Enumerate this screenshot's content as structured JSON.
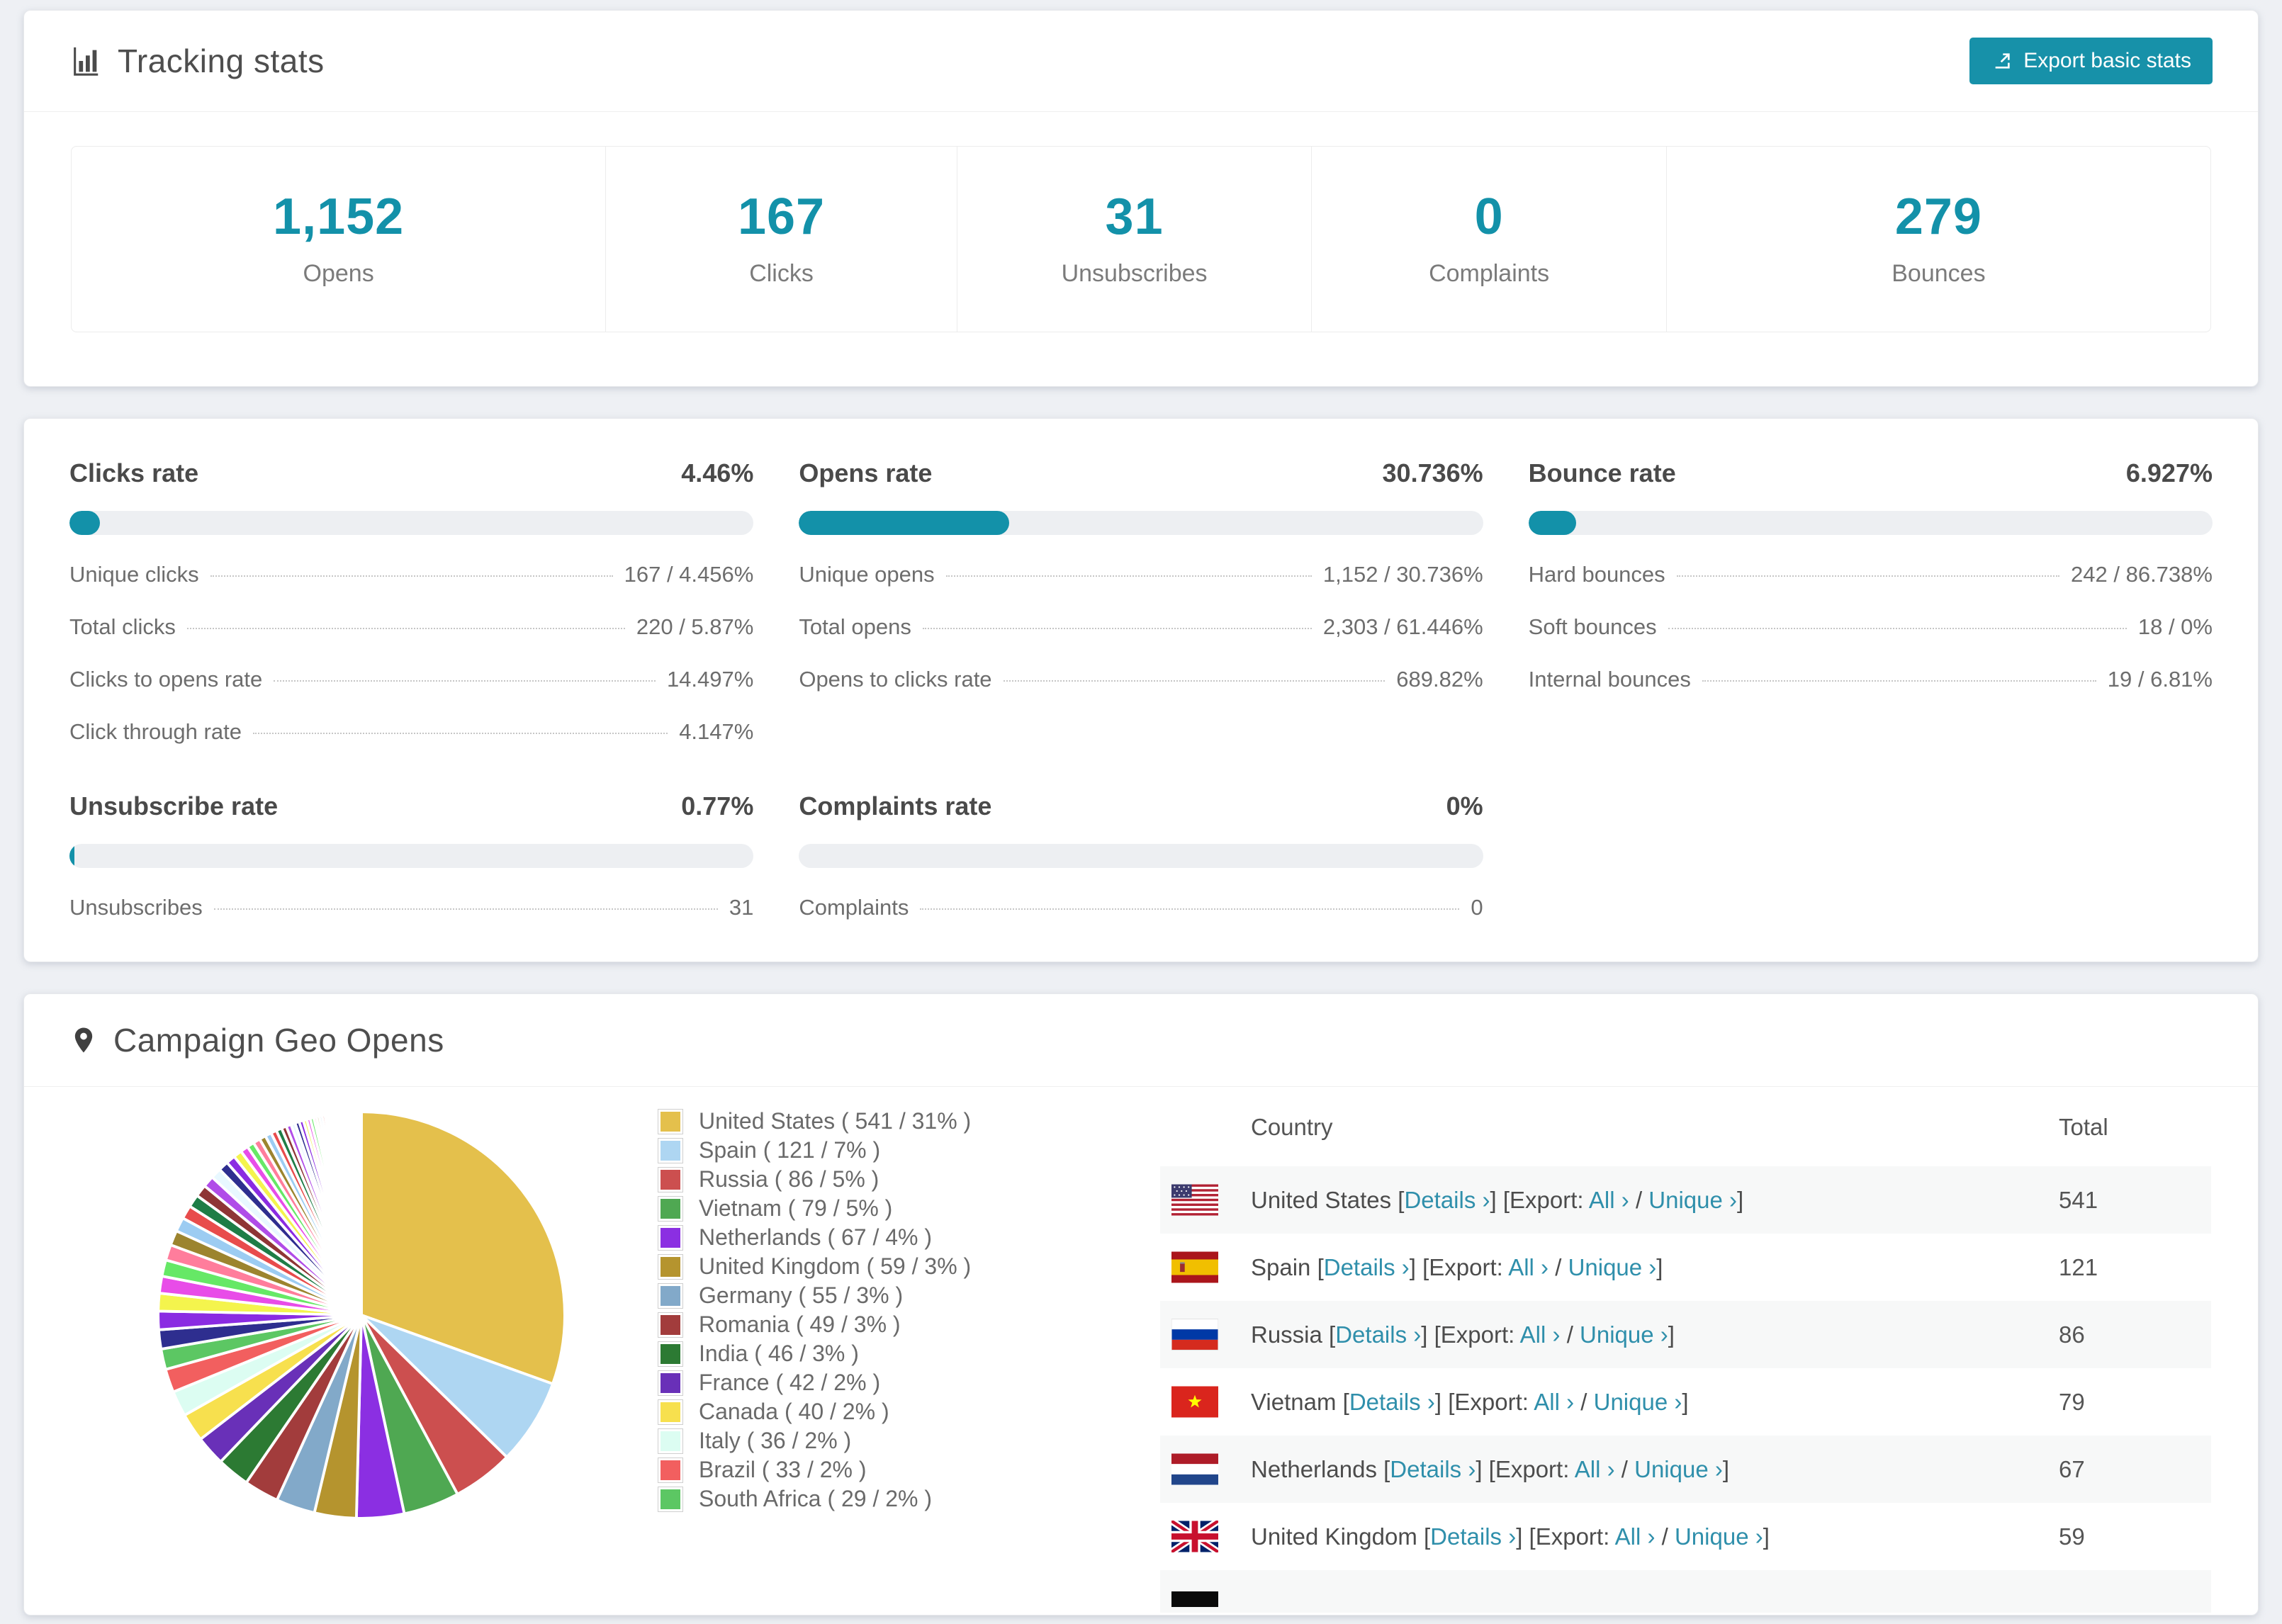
{
  "accent": "#1791a9",
  "tracking": {
    "title": "Tracking stats",
    "export_label": "Export basic stats",
    "stats": [
      {
        "value": "1,152",
        "label": "Opens"
      },
      {
        "value": "167",
        "label": "Clicks"
      },
      {
        "value": "31",
        "label": "Unsubscribes"
      },
      {
        "value": "0",
        "label": "Complaints"
      },
      {
        "value": "279",
        "label": "Bounces"
      }
    ]
  },
  "rates": [
    {
      "title": "Clicks rate",
      "value": "4.46%",
      "bar": 4.46,
      "rows": [
        {
          "label": "Unique clicks",
          "value": "167 / 4.456%"
        },
        {
          "label": "Total clicks",
          "value": "220 / 5.87%"
        },
        {
          "label": "Clicks to opens rate",
          "value": "14.497%"
        },
        {
          "label": "Click through rate",
          "value": "4.147%"
        }
      ]
    },
    {
      "title": "Opens rate",
      "value": "30.736%",
      "bar": 30.736,
      "rows": [
        {
          "label": "Unique opens",
          "value": "1,152 / 30.736%"
        },
        {
          "label": "Total opens",
          "value": "2,303 / 61.446%"
        },
        {
          "label": "Opens to clicks rate",
          "value": "689.82%"
        }
      ]
    },
    {
      "title": "Bounce rate",
      "value": "6.927%",
      "bar": 6.927,
      "rows": [
        {
          "label": "Hard bounces",
          "value": "242 / 86.738%"
        },
        {
          "label": "Soft bounces",
          "value": "18 / 0%"
        },
        {
          "label": "Internal bounces",
          "value": "19 / 6.81%"
        }
      ]
    },
    {
      "title": "Unsubscribe rate",
      "value": "0.77%",
      "bar": 0.77,
      "rows": [
        {
          "label": "Unsubscribes",
          "value": "31"
        }
      ]
    },
    {
      "title": "Complaints rate",
      "value": "0%",
      "bar": 0,
      "rows": [
        {
          "label": "Complaints",
          "value": "0"
        }
      ]
    }
  ],
  "geo": {
    "title": "Campaign Geo Opens",
    "legend": [
      {
        "label": "United States ( 541 / 31% )"
      },
      {
        "label": "Spain ( 121 / 7% )"
      },
      {
        "label": "Russia ( 86 / 5% )"
      },
      {
        "label": "Vietnam ( 79 / 5% )"
      },
      {
        "label": "Netherlands ( 67 / 4% )"
      },
      {
        "label": "United Kingdom ( 59 / 3% )"
      },
      {
        "label": "Germany ( 55 / 3% )"
      },
      {
        "label": "Romania ( 49 / 3% )"
      },
      {
        "label": "India ( 46 / 3% )"
      },
      {
        "label": "France ( 42 / 2% )"
      },
      {
        "label": "Canada ( 40 / 2% )"
      },
      {
        "label": "Italy ( 36 / 2% )"
      },
      {
        "label": "Brazil ( 33 / 2% )"
      },
      {
        "label": "South Africa ( 29 / 2% )"
      }
    ],
    "table": {
      "headers": [
        "Country",
        "Total"
      ],
      "link_labels": {
        "lb": "[",
        "rb": "]",
        "details": "Details ›",
        "export": "Export:",
        "all": "All ›",
        "slash": "/",
        "unique": "Unique ›"
      },
      "rows": [
        {
          "country": "United States",
          "total": "541"
        },
        {
          "country": "Spain",
          "total": "121"
        },
        {
          "country": "Russia",
          "total": "86"
        },
        {
          "country": "Vietnam",
          "total": "79"
        },
        {
          "country": "Netherlands",
          "total": "67"
        },
        {
          "country": "United Kingdom",
          "total": "59"
        }
      ]
    }
  },
  "chart_data": {
    "type": "pie",
    "title": "Campaign Geo Opens",
    "unit": "opens",
    "legend_position": "right",
    "series": [
      {
        "name": "United States",
        "value": 541,
        "percent": "31%",
        "color": "#e4c04c"
      },
      {
        "name": "Spain",
        "value": 121,
        "percent": "7%",
        "color": "#aed6f2"
      },
      {
        "name": "Russia",
        "value": 86,
        "percent": "5%",
        "color": "#cc4f4f"
      },
      {
        "name": "Vietnam",
        "value": 79,
        "percent": "5%",
        "color": "#4fa852"
      },
      {
        "name": "Netherlands",
        "value": 67,
        "percent": "4%",
        "color": "#8b2fe2"
      },
      {
        "name": "United Kingdom",
        "value": 59,
        "percent": "3%",
        "color": "#b5942e"
      },
      {
        "name": "Germany",
        "value": 55,
        "percent": "3%",
        "color": "#82a9c9"
      },
      {
        "name": "Romania",
        "value": 49,
        "percent": "3%",
        "color": "#a23c3c"
      },
      {
        "name": "India",
        "value": 46,
        "percent": "3%",
        "color": "#2c7a33"
      },
      {
        "name": "France",
        "value": 42,
        "percent": "2%",
        "color": "#6930b8"
      },
      {
        "name": "Canada",
        "value": 40,
        "percent": "2%",
        "color": "#f7e04e"
      },
      {
        "name": "Italy",
        "value": 36,
        "percent": "2%",
        "color": "#dcfdf2"
      },
      {
        "name": "Brazil",
        "value": 33,
        "percent": "2%",
        "color": "#f25f5f"
      },
      {
        "name": "South Africa",
        "value": 29,
        "percent": "2%",
        "color": "#5cc763"
      }
    ],
    "others": {
      "values": [
        27,
        26,
        25,
        24,
        23,
        22,
        21,
        20,
        19,
        18,
        17,
        16,
        15,
        14,
        13,
        12,
        11,
        10,
        10,
        9,
        9,
        8,
        8,
        7,
        7,
        6,
        6,
        6,
        5,
        5,
        5,
        4,
        4,
        4,
        4,
        3,
        3,
        3,
        3,
        3,
        3,
        2,
        2,
        2,
        2,
        2,
        2,
        2,
        2,
        2,
        1,
        1,
        1,
        1,
        1,
        1,
        1,
        1,
        1,
        1,
        1,
        1,
        1,
        1,
        1
      ],
      "palette": [
        "#2e2e8f",
        "#8a2be2",
        "#f4f44d",
        "#e84ce8",
        "#66e866",
        "#ff7d9c",
        "#9c842e",
        "#9cccf2",
        "#e84c4c",
        "#1e7d46",
        "#8f3535",
        "#b04ce8",
        "#e8f8ff"
      ]
    }
  }
}
